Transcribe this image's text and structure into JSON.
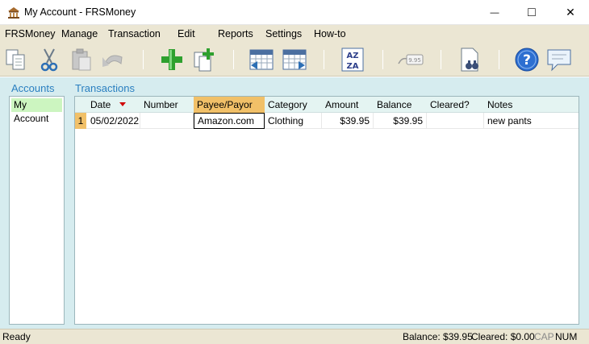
{
  "window": {
    "title": "My Account - FRSMoney",
    "min_glyph": "—",
    "max_glyph": "□",
    "close_glyph": "✕"
  },
  "menu": {
    "items": [
      "FRSMoney",
      "Manage",
      "Transaction",
      "Edit",
      "Reports",
      "Settings",
      "How-to"
    ]
  },
  "toolbar": {
    "buttons": [
      "copy-icon",
      "cut-icon",
      "paste-icon",
      "undo-icon",
      "add-icon",
      "duplicate-icon",
      "previous-period-icon",
      "next-period-icon",
      "sort-icon",
      "check-amount-icon",
      "find-icon",
      "help-icon",
      "feedback-icon"
    ],
    "sort_top": "AZ",
    "sort_bottom": "ZA",
    "amount_tag": "9.95"
  },
  "accounts": {
    "label": "Accounts",
    "items": [
      "My Account"
    ],
    "selected": "My Account"
  },
  "transactions": {
    "label": "Transactions",
    "columns": [
      "Date",
      "Number",
      "Payee/Payor",
      "Category",
      "Amount",
      "Balance",
      "Cleared?",
      "Notes"
    ],
    "sorted_column": "Date",
    "selected_column": "Payee/Payor",
    "rows": [
      {
        "index": "1",
        "date": "05/02/2022",
        "number": "",
        "payee": "Amazon.com",
        "category": "Clothing",
        "amount": "$39.95",
        "balance": "$39.95",
        "cleared": "",
        "notes": "new pants"
      }
    ]
  },
  "status": {
    "left": "Ready",
    "balance": "Balance: $39.95",
    "cleared": "Cleared: $0.00",
    "cap": "CAP",
    "num": "NUM"
  },
  "colors": {
    "accent_blue": "#2a7fc0",
    "selected_header": "#f1c068",
    "account_selected": "#ccf5c0",
    "content_bg": "#d6ecef",
    "chrome_bg": "#ebe6d3"
  }
}
